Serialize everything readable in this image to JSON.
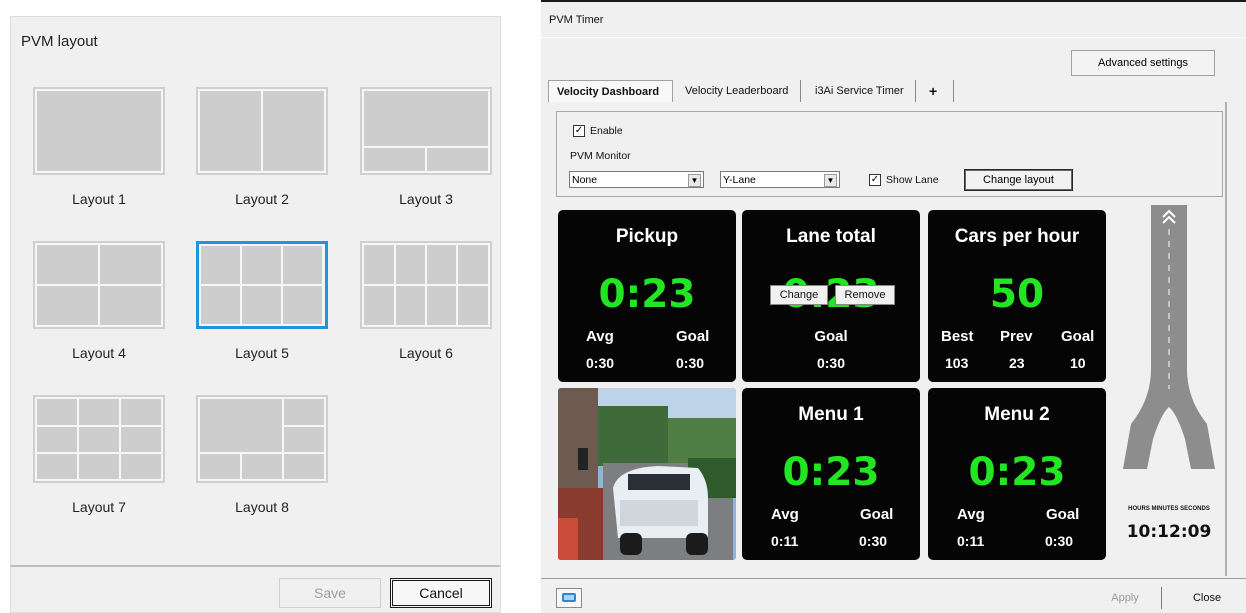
{
  "layout_dialog": {
    "title": "PVM layout",
    "layouts": [
      {
        "label": "Layout 1"
      },
      {
        "label": "Layout 2"
      },
      {
        "label": "Layout 3"
      },
      {
        "label": "Layout 4"
      },
      {
        "label": "Layout 5",
        "selected": true
      },
      {
        "label": "Layout 6"
      },
      {
        "label": "Layout 7"
      },
      {
        "label": "Layout 8"
      }
    ],
    "save_label": "Save",
    "cancel_label": "Cancel",
    "selection_color": "#1f95e0"
  },
  "timer_window": {
    "title": "PVM Timer",
    "advanced_settings_label": "Advanced settings",
    "tabs": [
      {
        "label": "Velocity Dashboard",
        "active": true
      },
      {
        "label": "Velocity Leaderboard"
      },
      {
        "label": "i3Ai Service Timer"
      },
      {
        "label": "+"
      }
    ],
    "settings": {
      "enable_label": "Enable",
      "enable_checked": true,
      "monitor_label": "PVM Monitor",
      "monitor_value": "None",
      "lane_value": "Y-Lane",
      "show_lane_label": "Show Lane",
      "show_lane_checked": true,
      "change_layout_label": "Change layout"
    },
    "tiles": {
      "pickup": {
        "title": "Pickup",
        "value": "0:23",
        "avg_label": "Avg",
        "avg": "0:30",
        "goal_label": "Goal",
        "goal": "0:30"
      },
      "lane_total": {
        "title": "Lane total",
        "value": "0:23",
        "goal_label": "Goal",
        "goal": "0:30",
        "change_label": "Change",
        "remove_label": "Remove"
      },
      "cars_per_hour": {
        "title": "Cars per hour",
        "value": "50",
        "best_label": "Best",
        "best": "103",
        "prev_label": "Prev",
        "prev": "23",
        "goal_label": "Goal",
        "goal": "10"
      },
      "menu1": {
        "title": "Menu 1",
        "value": "0:23",
        "avg_label": "Avg",
        "avg": "0:11",
        "goal_label": "Goal",
        "goal": "0:30"
      },
      "menu2": {
        "title": "Menu 2",
        "value": "0:23",
        "avg_label": "Avg",
        "avg": "0:11",
        "goal_label": "Goal",
        "goal": "0:30"
      }
    },
    "value_color": "#23e623",
    "clock_caption": "HOURS MINUTES SECONDS",
    "clock_time": "10:12:09",
    "apply_label": "Apply",
    "close_label": "Close"
  }
}
